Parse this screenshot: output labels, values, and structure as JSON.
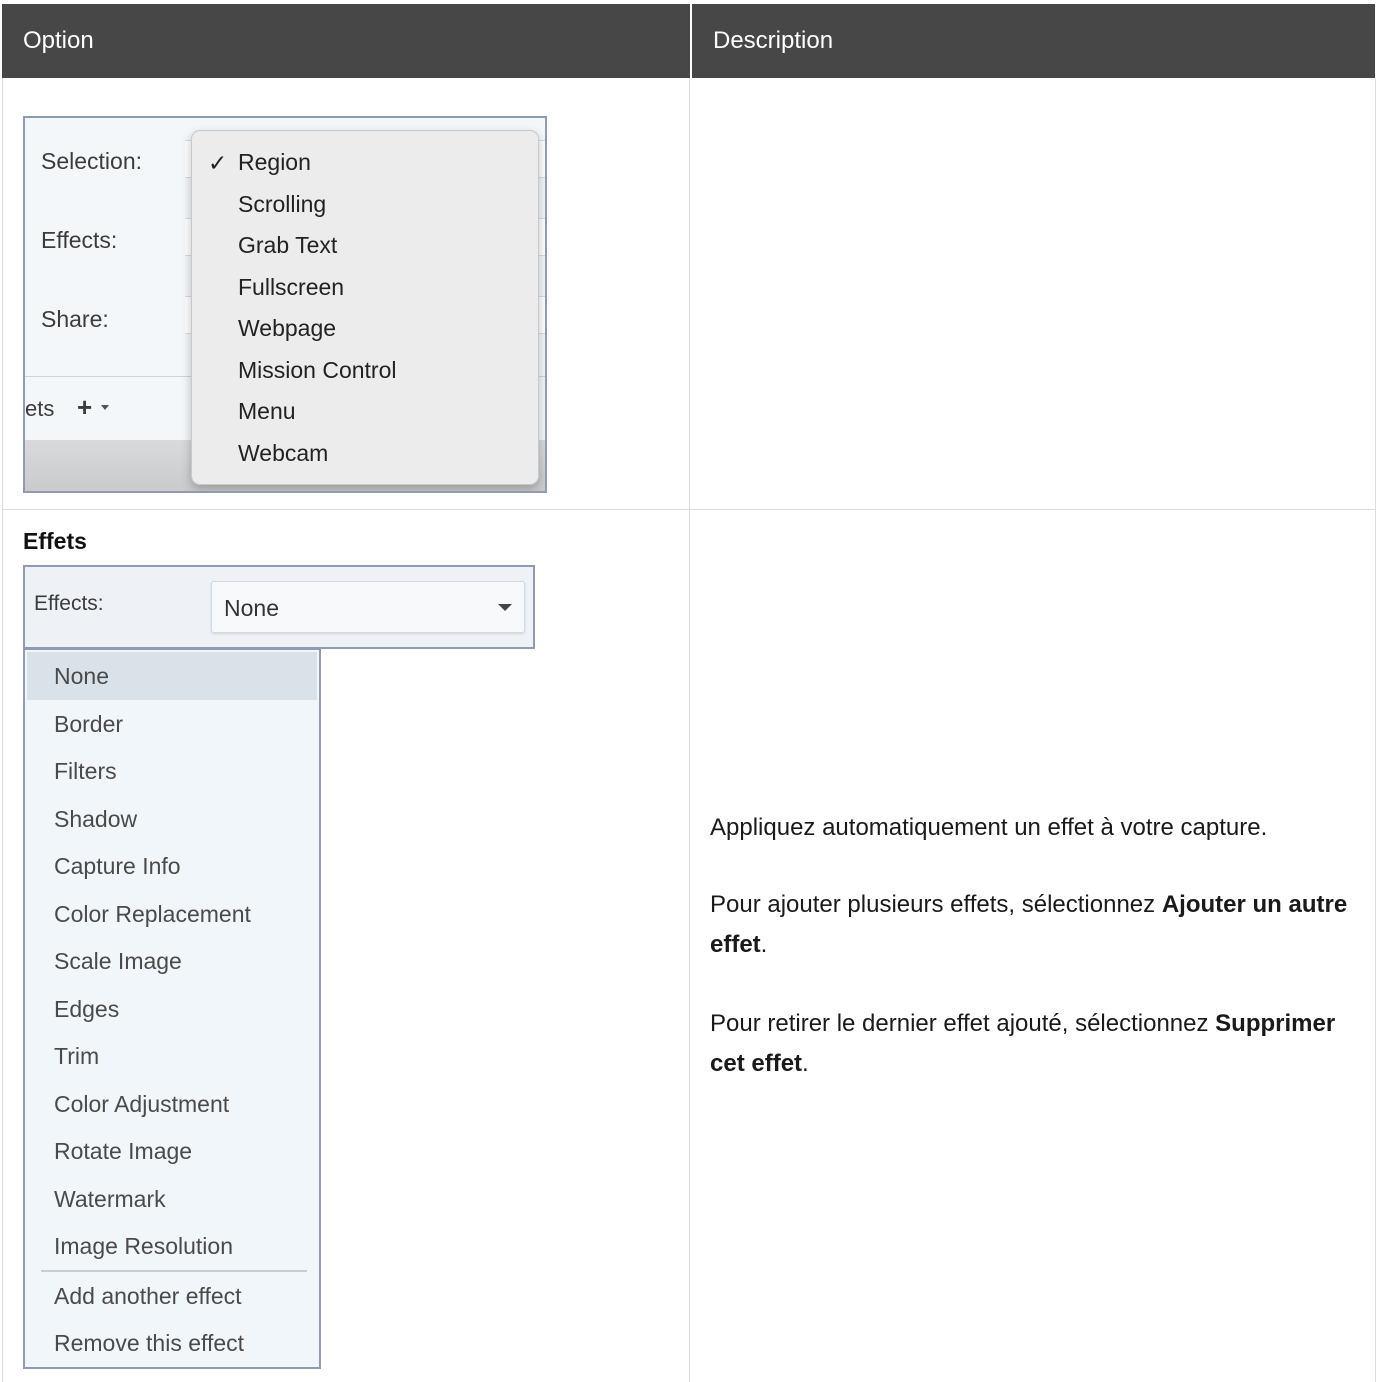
{
  "table": {
    "headers": {
      "option": "Option",
      "description": "Description"
    }
  },
  "row1": {
    "capture_window": {
      "labels": {
        "selection": "Selection:",
        "effects": "Effects:",
        "share": "Share:"
      },
      "presets_fragment": "ets",
      "plus_icon": "plus-icon",
      "selection_menu": {
        "checked_index": 0,
        "items": [
          "Region",
          "Scrolling",
          "Grab Text",
          "Fullscreen",
          "Webpage",
          "Mission Control",
          "Menu",
          "Webcam"
        ]
      }
    }
  },
  "row2": {
    "title": "Effets",
    "effects_control": {
      "label": "Effects:",
      "selected_value": "None"
    },
    "effects_list": {
      "items": [
        "None",
        "Border",
        "Filters",
        "Shadow",
        "Capture Info",
        "Color Replacement",
        "Scale Image",
        "Edges",
        "Trim",
        "Color Adjustment",
        "Rotate Image",
        "Watermark",
        "Image Resolution"
      ],
      "actions": [
        "Add another effect",
        "Remove this effect"
      ]
    },
    "description": {
      "p1": "Appliquez automatiquement un effet à votre capture.",
      "p2_before": "Pour ajouter plusieurs effets, sélectionnez ",
      "p2_bold": "Ajouter un autre effet",
      "p2_after": ".",
      "p3_before": "Pour retirer le dernier effet ajouté, sélectionnez ",
      "p3_bold": "Supprimer cet effet",
      "p3_after": "."
    }
  }
}
